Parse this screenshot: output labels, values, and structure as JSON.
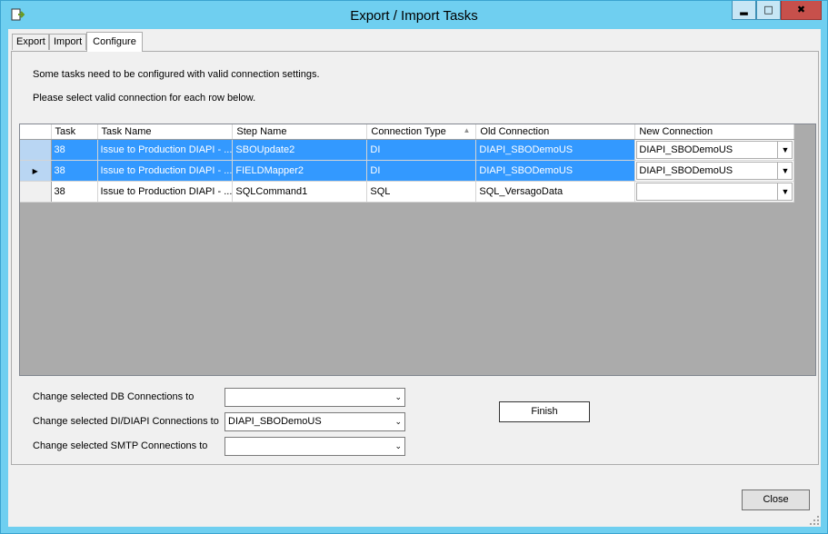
{
  "window": {
    "title": "Export / Import Tasks",
    "minimize_glyph": "▂",
    "maximize_glyph": "□",
    "close_glyph": "✖"
  },
  "tabs": [
    {
      "label": "Export",
      "active": false
    },
    {
      "label": "Import",
      "active": false
    },
    {
      "label": "Configure",
      "active": true
    }
  ],
  "info": {
    "line1": "Some tasks need to be configured with valid connection settings.",
    "line2": "Please select valid connection for each row below."
  },
  "grid": {
    "columns": [
      "Task",
      "Task Name",
      "Step Name",
      "Connection Type",
      "Old Connection",
      "New Connection"
    ],
    "sorted_column": "Connection Type",
    "rows": [
      {
        "task": "38",
        "task_name": "Issue to Production DIAPI - ...",
        "step_name": "SBOUpdate2",
        "connection_type": "DI",
        "old_connection": "DIAPI_SBODemoUS",
        "new_connection": "DIAPI_SBODemoUS",
        "selected": true,
        "current": false
      },
      {
        "task": "38",
        "task_name": "Issue to Production DIAPI - ...",
        "step_name": "FIELDMapper2",
        "connection_type": "DI",
        "old_connection": "DIAPI_SBODemoUS",
        "new_connection": "DIAPI_SBODemoUS",
        "selected": true,
        "current": true
      },
      {
        "task": "38",
        "task_name": "Issue to Production DIAPI - ...",
        "step_name": "SQLCommand1",
        "connection_type": "SQL",
        "old_connection": "SQL_VersagoData",
        "new_connection": "",
        "selected": false,
        "current": false
      }
    ]
  },
  "bulk": {
    "db_label": "Change selected DB Connections to",
    "db_value": "",
    "di_label": "Change selected DI/DIAPI Connections to",
    "di_value": "DIAPI_SBODemoUS",
    "smtp_label": "Change selected SMTP Connections to",
    "smtp_value": ""
  },
  "buttons": {
    "finish": "Finish",
    "close": "Close"
  },
  "colors": {
    "titlebar": "#6fcff0",
    "selection": "#3399ff",
    "close_button": "#c7504b"
  }
}
